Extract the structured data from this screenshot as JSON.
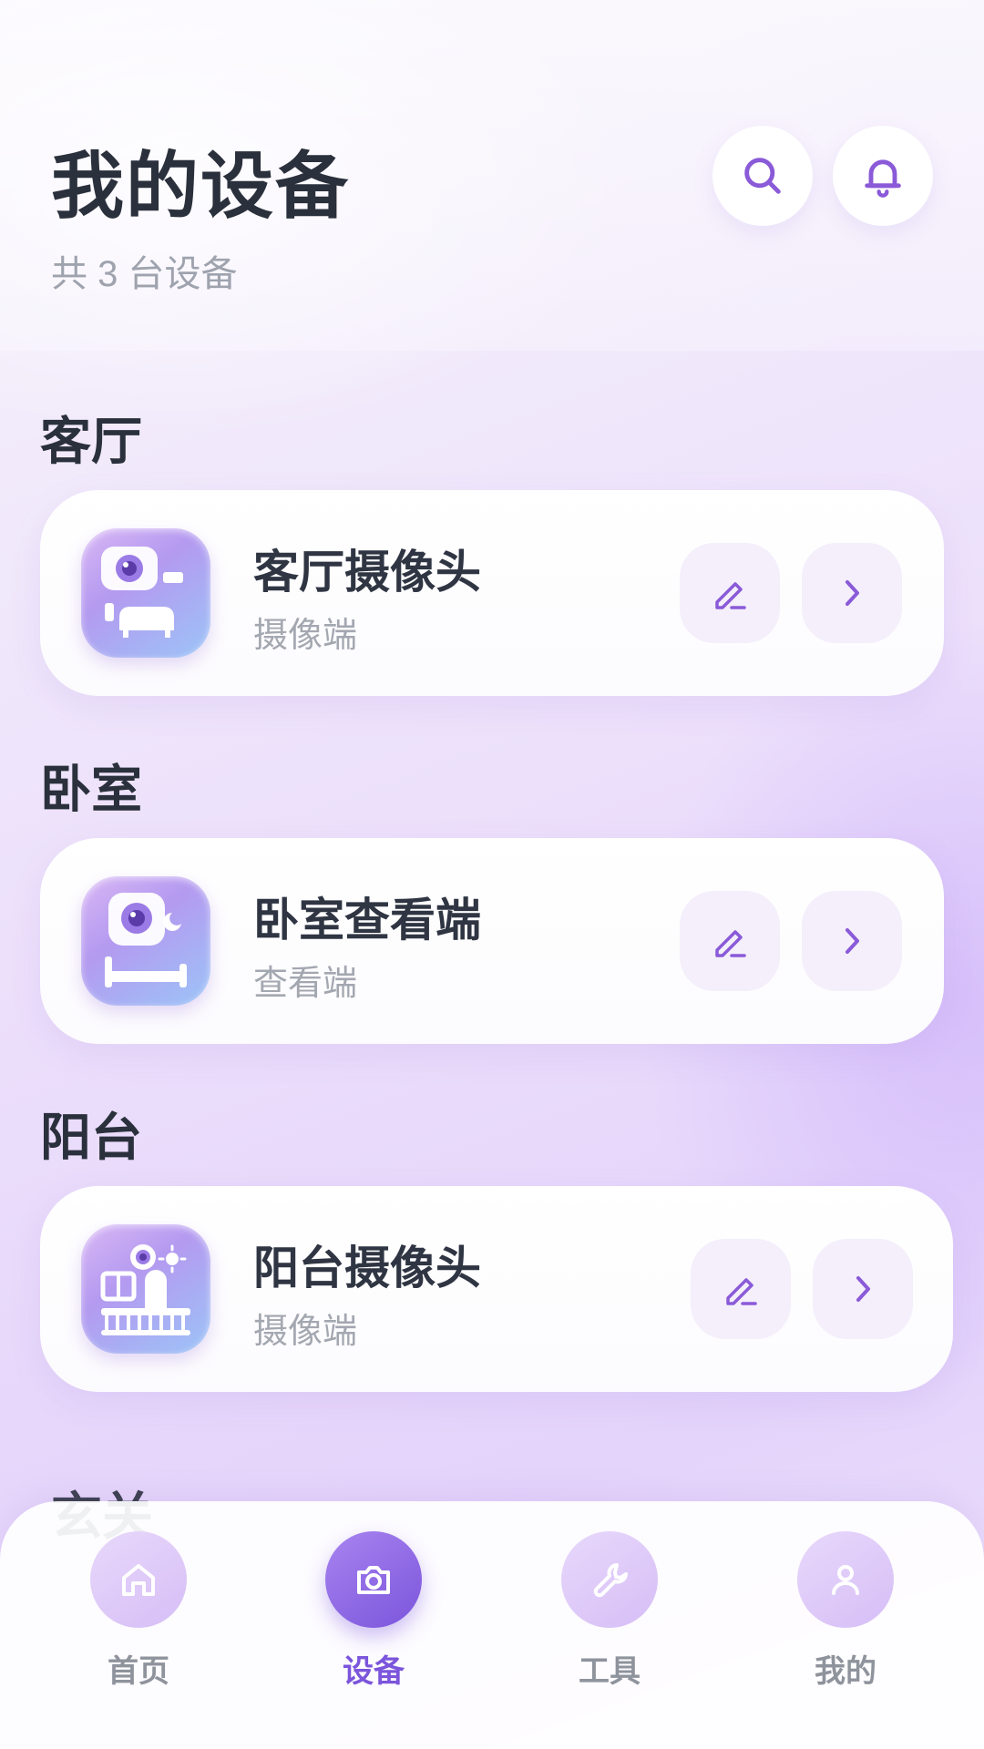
{
  "header": {
    "title": "我的设备",
    "subtitle": "共 3 台设备",
    "search_icon": "search-icon",
    "bell_icon": "bell-icon"
  },
  "sections": [
    {
      "title": "客厅",
      "device": {
        "name": "客厅摄像头",
        "type": "摄像端",
        "icon": "living-room-camera-icon"
      }
    },
    {
      "title": "卧室",
      "device": {
        "name": "卧室查看端",
        "type": "查看端",
        "icon": "bedroom-viewer-icon"
      }
    },
    {
      "title": "阳台",
      "device": {
        "name": "阳台摄像头",
        "type": "摄像端",
        "icon": "balcony-camera-icon"
      }
    }
  ],
  "peek_section_title": "玄关",
  "tabbar": {
    "tabs": [
      {
        "label": "首页",
        "icon": "home-icon",
        "active": false
      },
      {
        "label": "设备",
        "icon": "camera-icon",
        "active": true
      },
      {
        "label": "工具",
        "icon": "wrench-icon",
        "active": false
      },
      {
        "label": "我的",
        "icon": "user-icon",
        "active": false
      }
    ]
  },
  "colors": {
    "accent": "#7b55db",
    "icon_stroke": "#8a5ad8",
    "title_text": "#2a303c",
    "muted_text": "#a3a7b0"
  }
}
